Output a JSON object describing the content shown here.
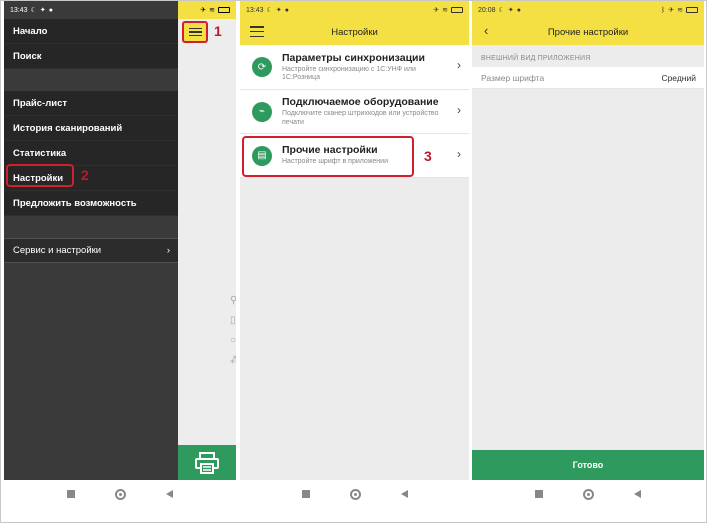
{
  "screen1": {
    "status": {
      "time": "13:43"
    },
    "drawer": {
      "top_items": [
        "Начало",
        "Поиск"
      ],
      "items": [
        "Прайс-лист",
        "История сканирований",
        "Статистика",
        "Настройки",
        "Предложить возможность"
      ],
      "service_item": "Сервис и настройки"
    },
    "annotations": {
      "menu": "1",
      "settings": "2"
    }
  },
  "screen2": {
    "status": {
      "time": "13:43"
    },
    "header": {
      "title": "Настройки"
    },
    "items": [
      {
        "title": "Параметры синхронизации",
        "subtitle": "Настройте синхронизацию с 1С:УНФ или 1С:Розница",
        "icon": "sync-icon"
      },
      {
        "title": "Подключаемое оборудование",
        "subtitle": "Подключите сканер штрихкодов или устройство печати",
        "icon": "scanner-icon"
      },
      {
        "title": "Прочие настройки",
        "subtitle": "Настройте шрифт в приложении",
        "icon": "phone-settings-icon"
      }
    ],
    "annotations": {
      "other": "3"
    }
  },
  "screen3": {
    "status": {
      "time": "20:08"
    },
    "header": {
      "title": "Прочие настройки"
    },
    "section": "ВНЕШНИЙ ВИД ПРИЛОЖЕНИЯ",
    "setting": {
      "label": "Размер шрифта",
      "value": "Средний"
    },
    "done": "Готово"
  },
  "colors": {
    "yellow": "#f5e044",
    "green": "#2e9a5e",
    "red": "#d0202e",
    "drawer": "#3a3a3a"
  }
}
